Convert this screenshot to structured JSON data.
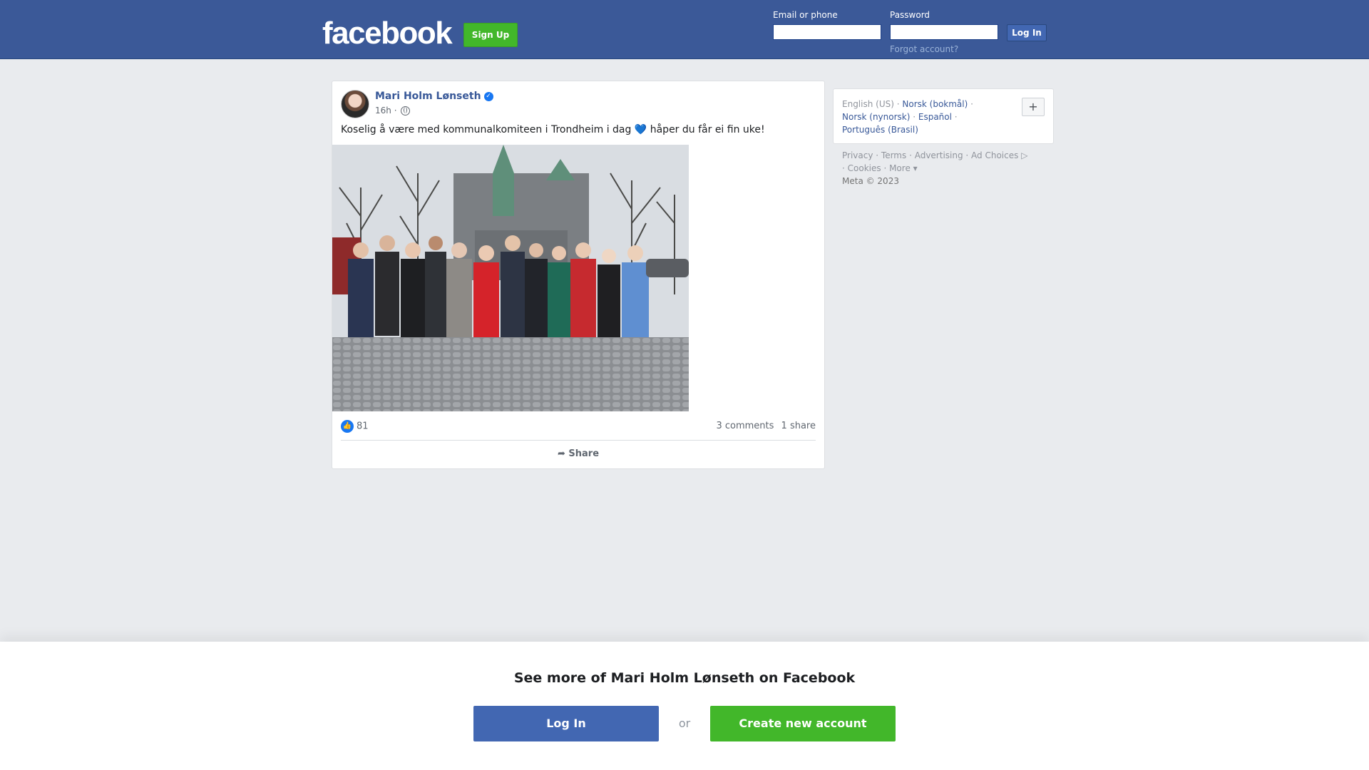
{
  "header": {
    "logo": "facebook",
    "signup_label": "Sign Up",
    "email_label": "Email or phone",
    "email_value": "",
    "password_label": "Password",
    "password_value": "",
    "login_label": "Log In",
    "forgot_label": "Forgot account?"
  },
  "post": {
    "author": "Mari Holm Lønseth",
    "verified_mark": "✓",
    "time": "16h ·",
    "privacy_icon": "globe-icon",
    "text": "Koselig å være med kommunalkomiteen i Trondheim i dag 💙 håper du får ei fin uke!",
    "like_count": "81",
    "comments": "3 comments",
    "shares": "1 share",
    "share_label": "Share"
  },
  "sidebar": {
    "current_language": "English (US)",
    "languages": [
      "Norsk (bokmål)",
      "Norsk (nynorsk)",
      "Español",
      "Português (Brasil)"
    ],
    "plus_label": "+",
    "footer_links": [
      "Privacy",
      "Terms",
      "Advertising",
      "Ad Choices",
      "Cookies",
      "More"
    ],
    "copyright": "Meta © 2023"
  },
  "banner": {
    "title": "See more of Mari Holm Lønseth on Facebook",
    "login_label": "Log In",
    "or_label": "or",
    "create_label": "Create new account"
  },
  "colors": {
    "brand_blue": "#3b5998",
    "button_blue": "#4267b2",
    "green": "#42b72a",
    "link": "#385898",
    "background": "#e9ebee"
  }
}
